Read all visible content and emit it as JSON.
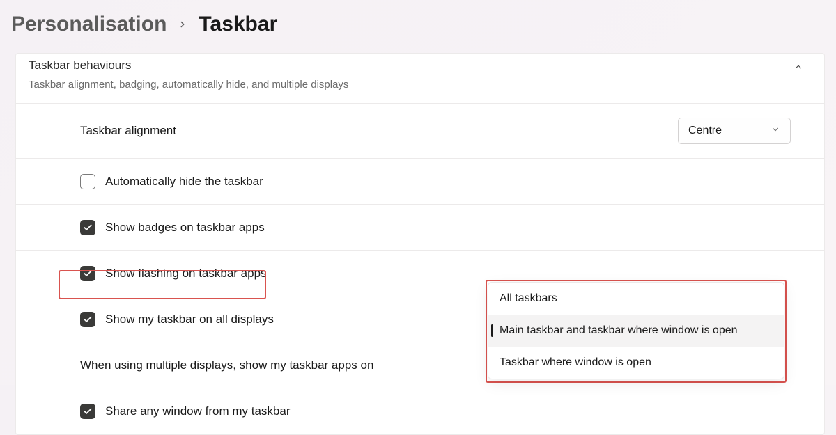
{
  "breadcrumb": {
    "parent": "Personalisation",
    "current": "Taskbar"
  },
  "section": {
    "title": "Taskbar behaviours",
    "subtitle": "Taskbar alignment, badging, automatically hide, and multiple displays"
  },
  "alignment": {
    "label": "Taskbar alignment",
    "selected": "Centre"
  },
  "options": {
    "auto_hide": {
      "label": "Automatically hide the taskbar",
      "checked": false
    },
    "badges": {
      "label": "Show badges on taskbar apps",
      "checked": true
    },
    "flashing": {
      "label": "Show flashing on taskbar apps",
      "checked": true
    },
    "all_displays": {
      "label": "Show my taskbar on all displays",
      "checked": true
    },
    "multi_label": {
      "label": "When using multiple displays, show my taskbar apps on"
    },
    "share_window": {
      "label": "Share any window from my taskbar",
      "checked": true
    }
  },
  "multi_menu": {
    "items": [
      "All taskbars",
      "Main taskbar and taskbar where window is open",
      "Taskbar where window is open"
    ],
    "selected_index": 1
  }
}
